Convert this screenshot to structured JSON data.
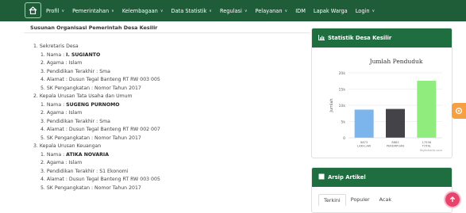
{
  "nav": {
    "items": [
      {
        "label": "Profil",
        "caret": true
      },
      {
        "label": "Pemerintahan",
        "caret": true
      },
      {
        "label": "Kelembagaan",
        "caret": true
      },
      {
        "label": "Data Statistik",
        "caret": true
      },
      {
        "label": "Regulasi",
        "caret": true
      },
      {
        "label": "Pelayanan",
        "caret": true
      },
      {
        "label": "IDM",
        "caret": false
      },
      {
        "label": "Lapak Warga",
        "caret": false
      },
      {
        "label": "Login",
        "caret": true
      }
    ]
  },
  "main": {
    "title": "Susunan Organisasi Pemerintah Desa Kesilir",
    "lines": [
      {
        "text": "1. Sekretaris Desa",
        "indent": false
      },
      {
        "prefix": "1. Nama : ",
        "bold": "I. SUGIANTO",
        "indent": true
      },
      {
        "text": "2. Agama : Islam",
        "indent": true
      },
      {
        "text": "3. Pendidikan Terakhir : Sma",
        "indent": true
      },
      {
        "text": "4. Alamat : Dusun Tegal Banteng RT RW 003 005",
        "indent": true
      },
      {
        "text": "5. SK Pengangkatan : Nomor   Tahun 2017",
        "indent": true
      },
      {
        "text": "2. Kepala Urusan Tata Usaha dan Umum",
        "indent": false
      },
      {
        "prefix": "1. Nama : ",
        "bold": "SUGENG PURNOMO",
        "indent": true
      },
      {
        "text": "2. Agama : Islam",
        "indent": true
      },
      {
        "text": "3. Pendidikan Terakhir : Sma",
        "indent": true
      },
      {
        "text": "4. Alamat : Dusun Tegal Banteng RT RW 002 007",
        "indent": true
      },
      {
        "text": "5. SK Pengangkatan : Nomor   Tahun 2017",
        "indent": true
      },
      {
        "text": "3. Kepala Urusan Keuangan",
        "indent": false
      },
      {
        "prefix": "1. Nama : ",
        "bold": "ATIKA NOVARIA",
        "indent": true
      },
      {
        "text": "2. Agama : Islam",
        "indent": true
      },
      {
        "text": "3. Pendidikan Terakhir : S1 Ekonomi",
        "indent": true
      },
      {
        "text": "4. Alamat : Dusun Tegal Banteng RT RW 003 005",
        "indent": true
      },
      {
        "text": "5. SK Pengangkatan : Nomor   Tahun 2017",
        "indent": true
      }
    ]
  },
  "sidebar": {
    "stat_title": "Statistik Desa Kesilir",
    "arsip_title": "Arsip Artikel",
    "tabs": [
      "Terkini",
      "Populer",
      "Acak"
    ]
  },
  "colors": {
    "nav_bg": "#1f5c38",
    "widget_head": "#1f6e3f",
    "bar_laki": "#7cb5ec",
    "bar_perempuan": "#434348",
    "bar_total": "#90ed7d",
    "side_button": "#f5a044",
    "scroll_top": "#e8436b"
  },
  "icons": {
    "home": "home-icon",
    "stat": "bar-chart-icon",
    "arsip": "archive-icon",
    "side": "gear-icon",
    "scroll": "arrow-up-icon"
  },
  "chart_data": {
    "type": "bar",
    "title": "Jumlah Penduduk",
    "ylabel": "Jumlah",
    "categories": [
      "8673 LAKI-LAKI",
      "8883 PEREMPUAN",
      "17556 TOTAL"
    ],
    "values": [
      8673,
      8883,
      17556
    ],
    "ylim": [
      0,
      20000
    ],
    "yticks": [
      "0",
      "5k",
      "10k",
      "15k",
      "20k"
    ],
    "credits": "Highcharts.com",
    "grid": true,
    "legend": "none"
  }
}
